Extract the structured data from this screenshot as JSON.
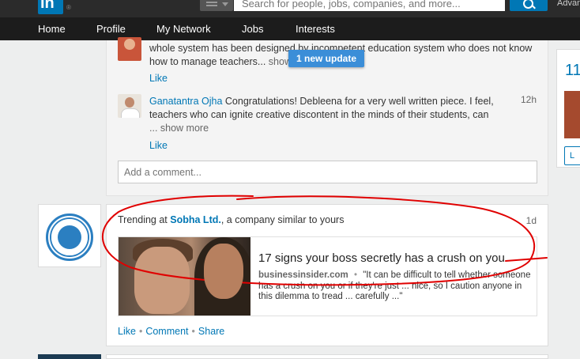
{
  "header": {
    "logo_text": "in",
    "logo_mark": "®",
    "search_placeholder": "Search for people, jobs, companies, and more...",
    "advanced_label": "Advan"
  },
  "nav": {
    "items": [
      "Home",
      "Profile",
      "My Network",
      "Jobs",
      "Interests"
    ]
  },
  "comments": [
    {
      "line1": "whole system has been designed by incompetent education system who does not know",
      "line2": "how to manage teachers...",
      "more": "show",
      "like": "Like"
    },
    {
      "author": "Ganatantra Ojha",
      "text": "Congratulations! Debleena for a very well written piece. I feel, teachers who can ignite creative discontent in the minds of their students, can",
      "more_prefix": "...",
      "more": "show more",
      "time": "12h",
      "like": "Like"
    }
  ],
  "comment_box_placeholder": "Add a comment...",
  "new_update_label": "1 new update",
  "trending": {
    "prefix": "Trending at",
    "company": "Sobha Ltd.",
    "suffix": ", a company similar to yours",
    "time": "1d",
    "article_title": "17 signs your boss secretly has a crush on you",
    "source": "businessinsider.com",
    "separator": "•",
    "snippet": "\"It can be difficult to tell whether someone has a crush on you or if they're just ... nice, so I caution anyone in this dilemma to tread ... carefully ...\"",
    "actions": [
      "Like",
      "Comment",
      "Share"
    ],
    "action_separator": "•"
  },
  "rail": {
    "number": "11",
    "button": "L"
  },
  "colors": {
    "brand": "#0077b5",
    "annotation": "#e00000"
  }
}
